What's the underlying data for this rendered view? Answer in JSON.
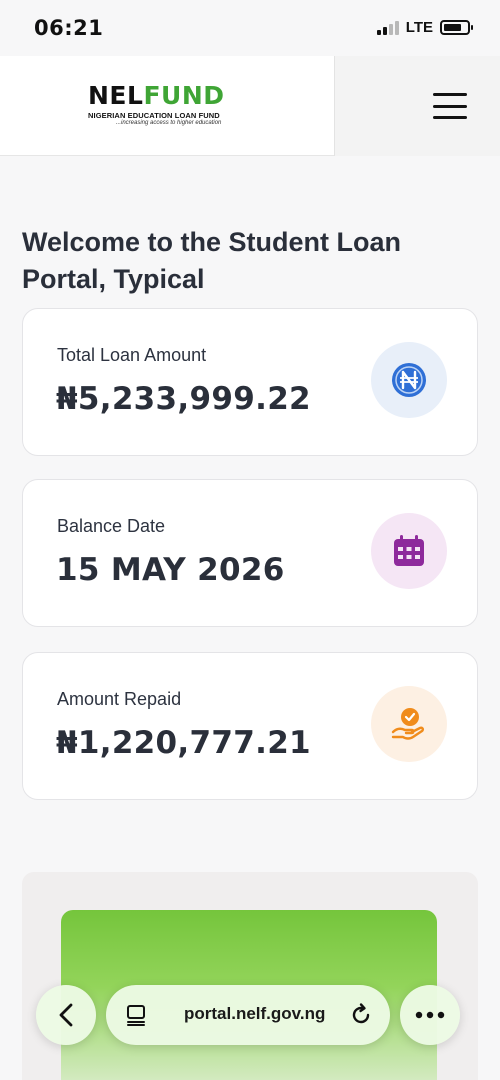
{
  "status": {
    "time": "06:21",
    "network": "LTE",
    "battery_level": 0.75
  },
  "header": {
    "logo": {
      "part1": "NEL",
      "part2": "FUND",
      "subtitle": "NIGERIAN EDUCATION LOAN FUND",
      "tagline": "...increasing access to higher education"
    },
    "menu_icon": "hamburger-icon"
  },
  "welcome": {
    "title": "Welcome to the Student Loan Portal, Typical"
  },
  "cards": [
    {
      "label": "Total Loan Amount",
      "value": "₦5,233,999.22",
      "icon": "naira-coin-icon",
      "icon_bg": "#e8eff9",
      "icon_color": "#2f6fd6"
    },
    {
      "label": "Balance Date",
      "value": "15 MAY 2026",
      "icon": "calendar-icon",
      "icon_bg": "#f5e6f5",
      "icon_color": "#8e2a9c"
    },
    {
      "label": "Amount Repaid",
      "value": "₦1,220,777.21",
      "icon": "hand-coin-icon",
      "icon_bg": "#fdf0e3",
      "icon_color": "#f08c1c"
    }
  ],
  "browser": {
    "url": "portal.nelf.gov.ng",
    "accent": "#ecfae4"
  },
  "colors": {
    "brand_green": "#3fa535",
    "text_dark": "#2a2f3a"
  }
}
